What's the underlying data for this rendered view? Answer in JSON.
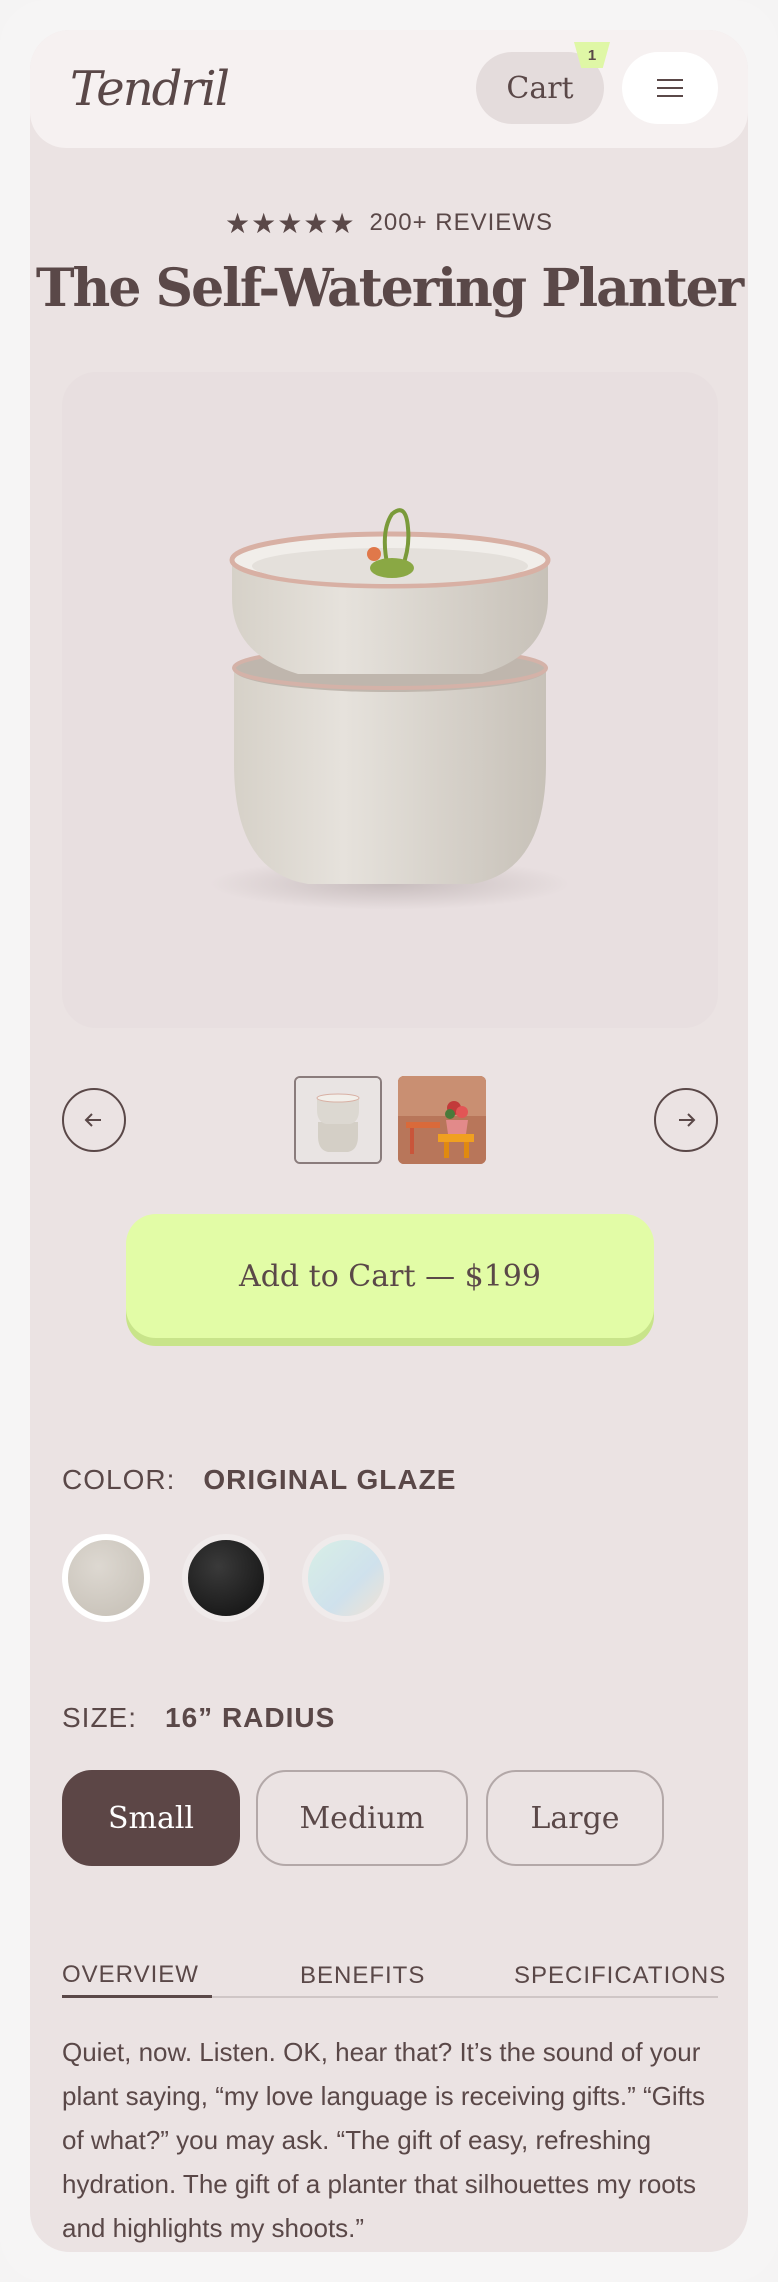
{
  "header": {
    "logo": "Tendril",
    "cart_label": "Cart",
    "cart_count": "1",
    "menu_icon": "hamburger-icon"
  },
  "product": {
    "stars": "★★★★★",
    "rating_stars": 5,
    "reviews_label": "200+ REVIEWS",
    "title": "The Self-Watering Planter",
    "image_alt": "Stacked beige ceramic self-watering planter with sprout"
  },
  "carousel": {
    "prev_icon": "arrow-left-icon",
    "next_icon": "arrow-right-icon",
    "selected_index": 0
  },
  "cta": {
    "add_to_cart": "Add to Cart — $199"
  },
  "options": {
    "color_label": "COLOR:",
    "color_value": "ORIGINAL GLAZE",
    "swatches": [
      {
        "name": "original-glaze",
        "color": "#cfc9c0"
      },
      {
        "name": "black",
        "color": "#1a1a1a"
      },
      {
        "name": "iridescent",
        "color": "#d4ebe8"
      }
    ],
    "size_label": "SIZE:",
    "size_value": "16” RADIUS",
    "sizes": [
      "Small",
      "Medium",
      "Large"
    ],
    "selected_size": "Small"
  },
  "tabs": {
    "items": [
      "OVERVIEW",
      "BENEFITS",
      "SPECIFICATIONS"
    ],
    "active": "OVERVIEW"
  },
  "description": "Quiet, now. Listen. OK, hear that? It’s the sound of your plant saying, “my love language is receiving gifts.” “Gifts of what?” you may ask. “The gift of easy, refreshing hydration. The gift of a planter that silhouettes my roots and highlights my shoots.”",
  "colors": {
    "accent": "#e2fca6",
    "text": "#5a4848",
    "background": "#ebe3e3",
    "selected_size_bg": "#5c4646"
  }
}
